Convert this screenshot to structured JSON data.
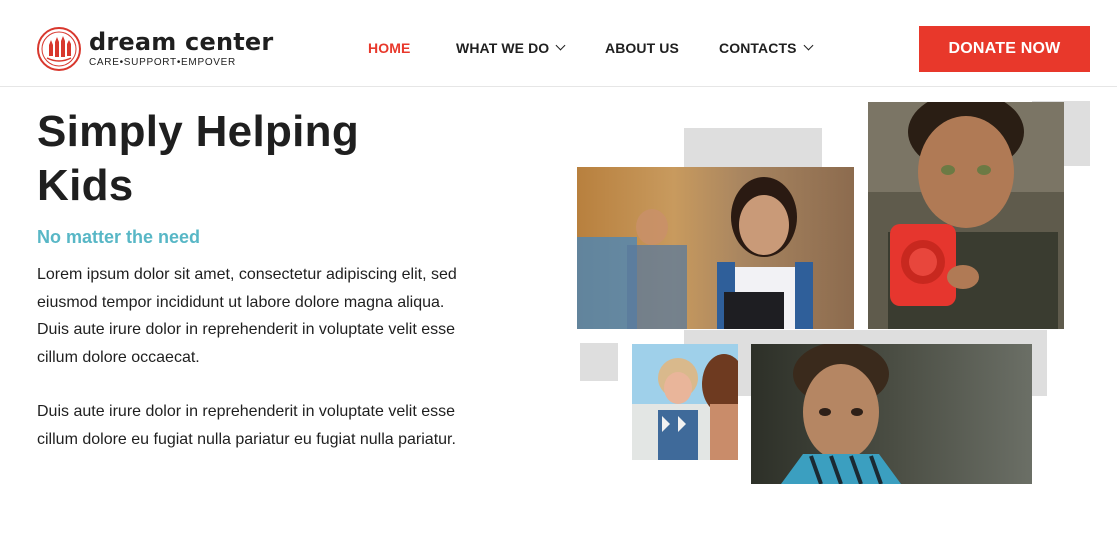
{
  "brand": {
    "name": "dream center",
    "tagline": "CARE•SUPPORT•EMPOVER",
    "logo_icon": "hands-circle-logo",
    "accent_color": "#e8382b"
  },
  "nav": {
    "items": [
      {
        "label": "HOME",
        "active": true,
        "dropdown": false
      },
      {
        "label": "WHAT WE DO",
        "active": false,
        "dropdown": true
      },
      {
        "label": "ABOUT US",
        "active": false,
        "dropdown": false
      },
      {
        "label": "CONTACTS",
        "active": false,
        "dropdown": true
      }
    ],
    "donate_label": "DONATE NOW"
  },
  "hero": {
    "title": "Simply Helping Kids",
    "subtitle": "No matter the need",
    "subtitle_color": "#58b7c6",
    "paragraph1": "Lorem ipsum dolor sit amet, consectetur adipiscing elit, sed eiusmod tempor incididunt ut labore dolore magna aliqua. Duis aute irure dolor in reprehenderit in voluptate velit esse cillum dolore occaecat.",
    "paragraph2": "Duis aute irure dolor in reprehenderit in voluptate velit esse cillum dolore eu fugiat nulla pariatur eu fugiat nulla pariatur."
  },
  "gallery": {
    "photos": [
      "girl-with-backpack-photo",
      "boy-with-red-radio-photo",
      "girl-at-beach-photo",
      "boy-portrait-photo"
    ]
  }
}
